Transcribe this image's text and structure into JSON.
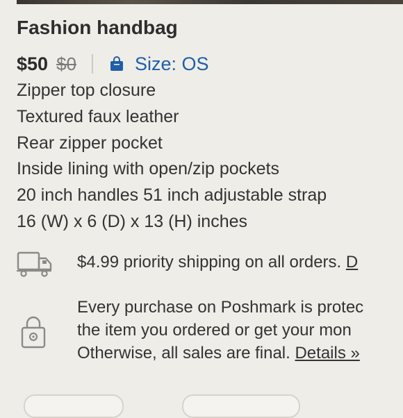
{
  "listing": {
    "title": "Fashion handbag",
    "price": "$50",
    "original_price": "$0",
    "size_label": "Size: OS"
  },
  "description": [
    "Zipper top closure",
    "Textured faux leather",
    "Rear zipper pocket",
    "Inside lining with open/zip pockets",
    "20 inch handles 51 inch adjustable strap",
    "16 (W) x 6 (D) x 13 (H) inches"
  ],
  "shipping": {
    "text": "$4.99 priority shipping on all orders. ",
    "link": "D"
  },
  "protection": {
    "line1": "Every purchase on Poshmark is protec",
    "line2": "the item you ordered or get your mon",
    "line3": "Otherwise, all sales are final. ",
    "details_link": "Details »"
  },
  "colors": {
    "accent_blue": "#1f5ea8",
    "text": "#333333",
    "background": "#efede8"
  },
  "icons": {
    "size": "shopping-bag-icon",
    "shipping": "truck-icon",
    "protection": "lock-icon"
  }
}
